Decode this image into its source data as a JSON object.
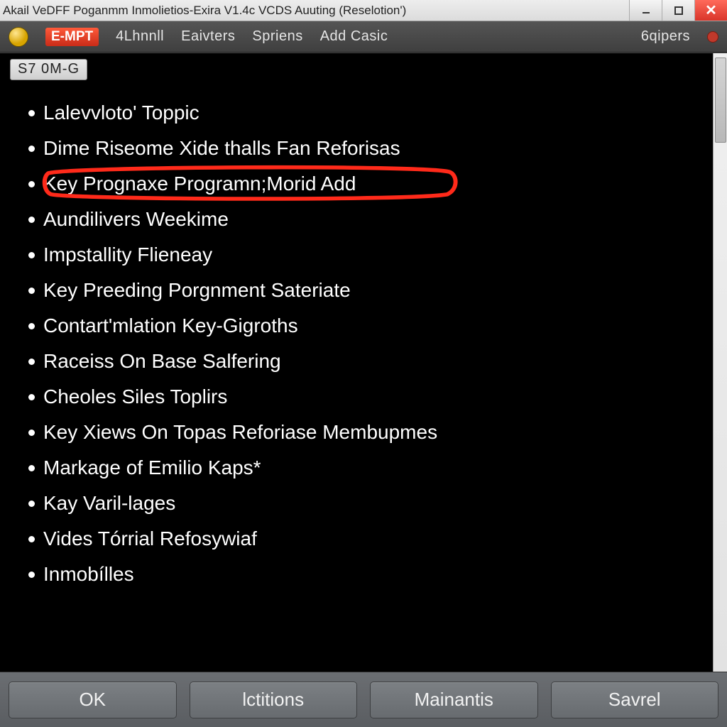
{
  "titlebar": {
    "title": "Akail VeDFF Poganmm Inmolietios-Exira V1.4c VCDS Auuting (Reselotion')"
  },
  "toolbar": {
    "empt": "E-MPT",
    "items": [
      "4Lhnnll",
      "Eaivters",
      "Spriens",
      "Add Casic"
    ],
    "right": "6qipers"
  },
  "chip": "S7 0M-G",
  "list": {
    "items": [
      "Lalevvloto' Toppic",
      "Dime Riseome Xide thalls Fan Reforisas",
      "Key Prognaxe Programn;Morid Add",
      "Aundilivers Weekime",
      "Impstallity Flieneay",
      "Key Preeding Porgnment Sateriate",
      "Contart'mlation Key-Gigroths",
      "Raceiss On Base Salfering",
      "Cheoles Siles Toplirs",
      "Key Xiews On Topas Reforiase Membupmes",
      "Markage of Emilio  Kaps*",
      "Kay Varil-lages",
      "Vides Tórrial Refosywiaf",
      "Inmobílles"
    ],
    "highlighted_index": 2
  },
  "bottombar": {
    "buttons": [
      "OK",
      "lctitions",
      "Mainantis",
      "Savrel"
    ]
  }
}
